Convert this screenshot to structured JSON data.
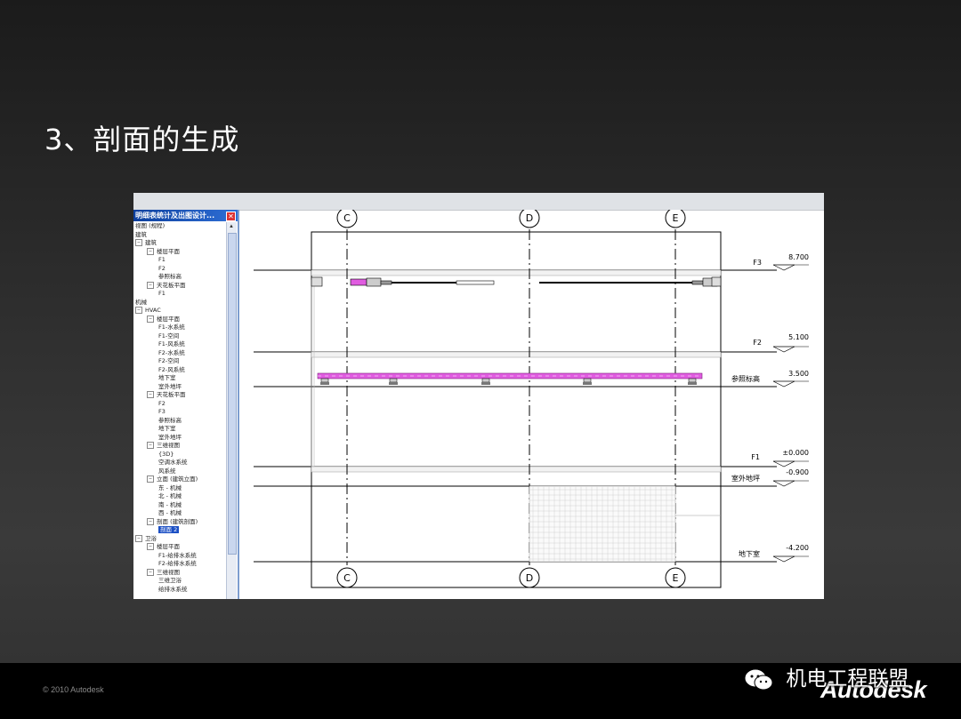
{
  "slide": {
    "title": "3、剖面的生成",
    "copyright": "© 2010 Autodesk",
    "brand": "Autodesk"
  },
  "watermark": {
    "text": "机电工程联盟",
    "icon": "wechat-icon"
  },
  "browser": {
    "title": "明细表统计及出图设计...",
    "close": "✕",
    "tree": [
      {
        "text": "视图 (规程)",
        "level": 0,
        "exp": ""
      },
      {
        "text": "建筑",
        "level": 0,
        "exp": ""
      },
      {
        "text": "建筑",
        "level": 0,
        "exp": "−"
      },
      {
        "text": "楼层平面",
        "level": 1,
        "exp": "−"
      },
      {
        "text": "F1",
        "level": 2,
        "exp": ""
      },
      {
        "text": "F2",
        "level": 2,
        "exp": ""
      },
      {
        "text": "参照标高",
        "level": 2,
        "exp": ""
      },
      {
        "text": "天花板平面",
        "level": 1,
        "exp": "−"
      },
      {
        "text": "F1",
        "level": 2,
        "exp": ""
      },
      {
        "text": "机械",
        "level": 0,
        "exp": ""
      },
      {
        "text": "HVAC",
        "level": 0,
        "exp": "−"
      },
      {
        "text": "楼层平面",
        "level": 1,
        "exp": "−"
      },
      {
        "text": "F1-水系统",
        "level": 2,
        "exp": ""
      },
      {
        "text": "F1-空间",
        "level": 2,
        "exp": ""
      },
      {
        "text": "F1-风系统",
        "level": 2,
        "exp": ""
      },
      {
        "text": "F2-水系统",
        "level": 2,
        "exp": ""
      },
      {
        "text": "F2-空间",
        "level": 2,
        "exp": ""
      },
      {
        "text": "F2-风系统",
        "level": 2,
        "exp": ""
      },
      {
        "text": "地下室",
        "level": 2,
        "exp": ""
      },
      {
        "text": "室外地坪",
        "level": 2,
        "exp": ""
      },
      {
        "text": "天花板平面",
        "level": 1,
        "exp": "−"
      },
      {
        "text": "F2",
        "level": 2,
        "exp": ""
      },
      {
        "text": "F3",
        "level": 2,
        "exp": ""
      },
      {
        "text": "参照标高",
        "level": 2,
        "exp": ""
      },
      {
        "text": "地下室",
        "level": 2,
        "exp": ""
      },
      {
        "text": "室外地坪",
        "level": 2,
        "exp": ""
      },
      {
        "text": "三维视图",
        "level": 1,
        "exp": "−"
      },
      {
        "text": "{3D}",
        "level": 2,
        "exp": ""
      },
      {
        "text": "空调水系统",
        "level": 2,
        "exp": ""
      },
      {
        "text": "风系统",
        "level": 2,
        "exp": ""
      },
      {
        "text": "立面 (建筑立面)",
        "level": 1,
        "exp": "−"
      },
      {
        "text": "东 - 机械",
        "level": 2,
        "exp": ""
      },
      {
        "text": "北 - 机械",
        "level": 2,
        "exp": ""
      },
      {
        "text": "南 - 机械",
        "level": 2,
        "exp": ""
      },
      {
        "text": "西 - 机械",
        "level": 2,
        "exp": ""
      },
      {
        "text": "剖面 (建筑剖面)",
        "level": 1,
        "exp": "−"
      },
      {
        "text": "剖面 2",
        "level": 2,
        "exp": "",
        "selected": true
      },
      {
        "text": "卫浴",
        "level": 0,
        "exp": "−"
      },
      {
        "text": "楼层平面",
        "level": 1,
        "exp": "−"
      },
      {
        "text": "F1-给排水系统",
        "level": 2,
        "exp": ""
      },
      {
        "text": "F2-给排水系统",
        "level": 2,
        "exp": ""
      },
      {
        "text": "三维视图",
        "level": 1,
        "exp": "−"
      },
      {
        "text": "三维卫浴",
        "level": 2,
        "exp": ""
      },
      {
        "text": "给排水系统",
        "level": 2,
        "exp": ""
      }
    ]
  },
  "section": {
    "grids": [
      "C",
      "D",
      "E"
    ],
    "levels": [
      {
        "name": "F3",
        "value": "8.700"
      },
      {
        "name": "F2",
        "value": "5.100"
      },
      {
        "name": "参照标高",
        "value": "3.500"
      },
      {
        "name": "F1",
        "value": "±0.000"
      },
      {
        "name": "室外地坪",
        "value": "-0.900"
      },
      {
        "name": "地下室",
        "value": "-4.200"
      }
    ],
    "colors": {
      "duct": "#e05ce0",
      "line": "#000000"
    }
  }
}
